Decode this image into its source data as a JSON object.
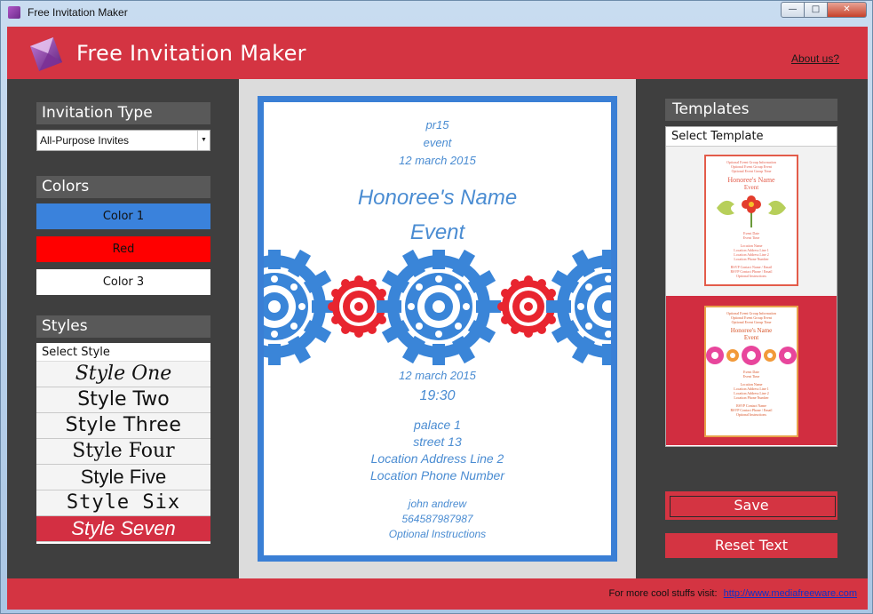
{
  "window": {
    "title": "Free Invitation Maker",
    "min": "—",
    "max": "□",
    "close": "✕"
  },
  "header": {
    "title": "Free Invitation Maker",
    "about": "About us?"
  },
  "invitation_type": {
    "label": "Invitation Type",
    "selected": "All-Purpose Invites",
    "arrow": "▼"
  },
  "colors": {
    "label": "Colors",
    "items": [
      {
        "label": "Color 1",
        "bg": "#3a82dc",
        "fg": "#111111"
      },
      {
        "label": "Red",
        "bg": "#ff0000",
        "fg": "#111111"
      },
      {
        "label": "Color 3",
        "bg": "#ffffff",
        "fg": "#111111"
      }
    ]
  },
  "styles": {
    "label": "Styles",
    "placeholder": "Select Style",
    "items": [
      "Style One",
      "Style Two",
      "Style Three",
      "Style Four",
      "Style Five",
      "Style Six",
      "Style Seven"
    ],
    "selected_index": 6
  },
  "invitation": {
    "line1": "pr15",
    "line2": "event",
    "line3": "12 march 2015",
    "honoree": "Honoree's Name",
    "event": "Event",
    "date": "12 march 2015",
    "time": "19:30",
    "address1": "palace 1",
    "address2": "street 13",
    "address3": "Location Address Line 2",
    "phone": "Location Phone Number",
    "rsvp_name": "john andrew",
    "rsvp_phone": "564587987987",
    "instructions": "Optional Instructions",
    "border_color": "#3a7fd5",
    "text_color": "#4a8cd2",
    "accent_color": "#e8252f"
  },
  "templates": {
    "label": "Templates",
    "placeholder": "Select Template",
    "t1": {
      "top": [
        "Optional Event Group Information",
        "Optional Event Group Event",
        "Optional Event Group Time"
      ],
      "honoree": "Honoree's Name",
      "event": "Event",
      "mid": [
        "Event Date",
        "Event Time"
      ],
      "loc": [
        "Location Name",
        "Location Address Line 1",
        "Location Address Line 2",
        "Location Phone Number"
      ],
      "bottom": [
        "RSVP Contact Name / Email",
        "RSVP Contact Phone / Email",
        "Optional Instructions"
      ]
    },
    "t2": {
      "top": [
        "Optional Event Group Information",
        "Optional Event Group Event",
        "Optional Event Group Time"
      ],
      "honoree": "Honoree's Name",
      "event": "Event",
      "mid": [
        "Event Date",
        "Event Time"
      ],
      "loc": [
        "Location Name",
        "Location Address Line 1",
        "Location Address Line 2",
        "Location Phone Number"
      ],
      "bottom": [
        "RSVP Contact Name",
        "RSVP Contact Phone / Email",
        "Optional Instructions"
      ]
    }
  },
  "actions": {
    "save": "Save",
    "reset": "Reset Text"
  },
  "footer": {
    "text": "For more cool stuffs visit:",
    "link": "http://www.mediafreeware.com"
  }
}
